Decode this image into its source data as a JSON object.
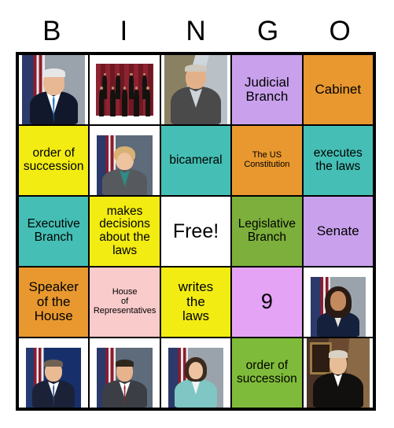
{
  "header": {
    "letters": [
      "B",
      "I",
      "N",
      "G",
      "O"
    ]
  },
  "colors": {
    "yellow": "#F2EC12",
    "teal": "#45BFB5",
    "purple": "#C9A0EC",
    "orchid": "#E4A3F5",
    "orange": "#E8982E",
    "green_olive": "#7CAF3B",
    "green_bright": "#7FBB3A",
    "pink": "#F9CBCB",
    "white": "#FFFFFF",
    "border": "#000000",
    "text": "#000000"
  },
  "grid": {
    "columns": 5,
    "rows": 5,
    "cells": [
      {
        "type": "image",
        "image": "photo-joe-biden",
        "alt": "President Joe Biden portrait with American flag",
        "bg": "white"
      },
      {
        "type": "image",
        "image": "photo-supreme-court",
        "alt": "Supreme Court justices group portrait",
        "bg": "white"
      },
      {
        "type": "image",
        "image": "photo-chuck-schumer",
        "alt": "Senator Chuck Schumer portrait",
        "bg": "white"
      },
      {
        "type": "text",
        "text": "Judicial\nBranch",
        "bg": "purple",
        "size": "t-lg"
      },
      {
        "type": "text",
        "text": "Cabinet",
        "bg": "orange",
        "size": "t-lg"
      },
      {
        "type": "text",
        "text": "order of\nsuccession",
        "bg": "yellow",
        "size": "t-md"
      },
      {
        "type": "image",
        "image": "photo-patty-murray",
        "alt": "Senator portrait with American flag",
        "bg": "white"
      },
      {
        "type": "text",
        "text": "bicameral",
        "bg": "teal",
        "size": "t-md"
      },
      {
        "type": "text",
        "text": "The US\nConstitution",
        "bg": "orange",
        "size": "t-sm"
      },
      {
        "type": "text",
        "text": "executes\nthe laws",
        "bg": "teal",
        "size": "t-md"
      },
      {
        "type": "text",
        "text": "Executive\nBranch",
        "bg": "teal",
        "size": "t-md"
      },
      {
        "type": "text",
        "text": "makes\ndecisions\nabout the\nlaws",
        "bg": "yellow",
        "size": "t-md"
      },
      {
        "type": "text",
        "text": "Free!",
        "bg": "white",
        "size": "t-free"
      },
      {
        "type": "text",
        "text": "Legislative\nBranch",
        "bg": "green_olive",
        "size": "t-md"
      },
      {
        "type": "text",
        "text": "Senate",
        "bg": "purple",
        "size": "t-lg"
      },
      {
        "type": "text",
        "text": "Speaker\nof the\nHouse",
        "bg": "orange",
        "size": "t-lg"
      },
      {
        "type": "text",
        "text": "House\nof\nRepresentatives",
        "bg": "pink",
        "size": "t-sm"
      },
      {
        "type": "text",
        "text": "writes\nthe\nlaws",
        "bg": "yellow",
        "size": "t-lg"
      },
      {
        "type": "text",
        "text": "9",
        "bg": "orchid",
        "size": "t-num"
      },
      {
        "type": "image",
        "image": "photo-kamala-harris",
        "alt": "Vice President Kamala Harris portrait with American flag",
        "bg": "white"
      },
      {
        "type": "image",
        "image": "photo-antony-blinken",
        "alt": "Secretary Antony Blinken portrait with American flag",
        "bg": "white"
      },
      {
        "type": "image",
        "image": "photo-mike-johnson",
        "alt": "Speaker Mike Johnson portrait with American flag",
        "bg": "white"
      },
      {
        "type": "image",
        "image": "photo-gina-raimondo",
        "alt": "Cabinet secretary portrait with American flag",
        "bg": "white"
      },
      {
        "type": "text",
        "text": "order of\nsuccession",
        "bg": "green_bright",
        "size": "t-md"
      },
      {
        "type": "image",
        "image": "photo-chief-justice",
        "alt": "Judge in black robe portrait",
        "bg": "white"
      }
    ]
  }
}
